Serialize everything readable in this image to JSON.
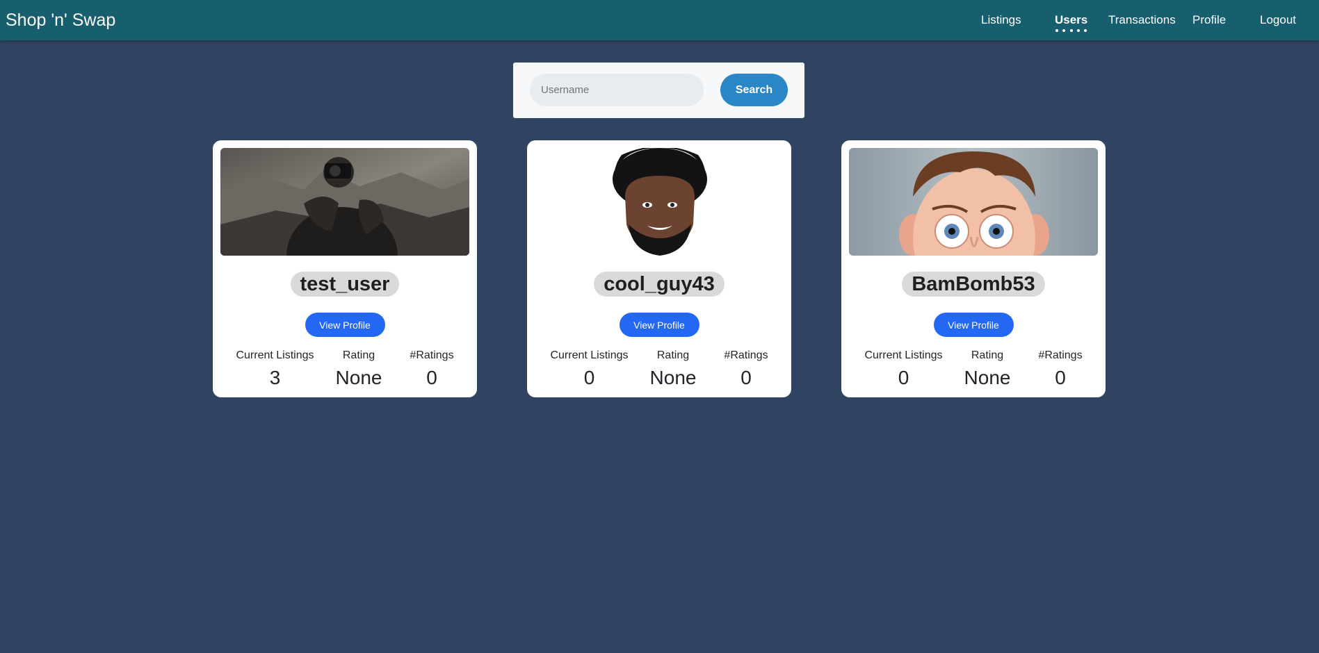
{
  "navbar": {
    "brand": "Shop 'n' Swap",
    "items": [
      {
        "label": "Listings",
        "active": false
      },
      {
        "label": "Users",
        "active": true
      },
      {
        "label": "Transactions",
        "active": false
      },
      {
        "label": "Profile",
        "active": false
      },
      {
        "label": "Logout",
        "active": false
      }
    ]
  },
  "search": {
    "placeholder": "Username",
    "value": "",
    "button_label": "Search"
  },
  "stat_labels": {
    "listings": "Current Listings",
    "rating": "Rating",
    "num_ratings": "#Ratings"
  },
  "users": [
    {
      "username": "test_user",
      "image": "photographer-photo",
      "view_label": "View Profile",
      "current_listings": "3",
      "rating": "None",
      "num_ratings": "0"
    },
    {
      "username": "cool_guy43",
      "image": "smiling-man-photo",
      "view_label": "View Profile",
      "current_listings": "0",
      "rating": "None",
      "num_ratings": "0"
    },
    {
      "username": "BamBomb53",
      "image": "cartoon-face-illustration",
      "view_label": "View Profile",
      "current_listings": "0",
      "rating": "None",
      "num_ratings": "0"
    }
  ],
  "colors": {
    "navbar": "#175f6e",
    "page_background": "#304461",
    "search_button": "#2b86c5",
    "view_button": "#2367f2"
  }
}
